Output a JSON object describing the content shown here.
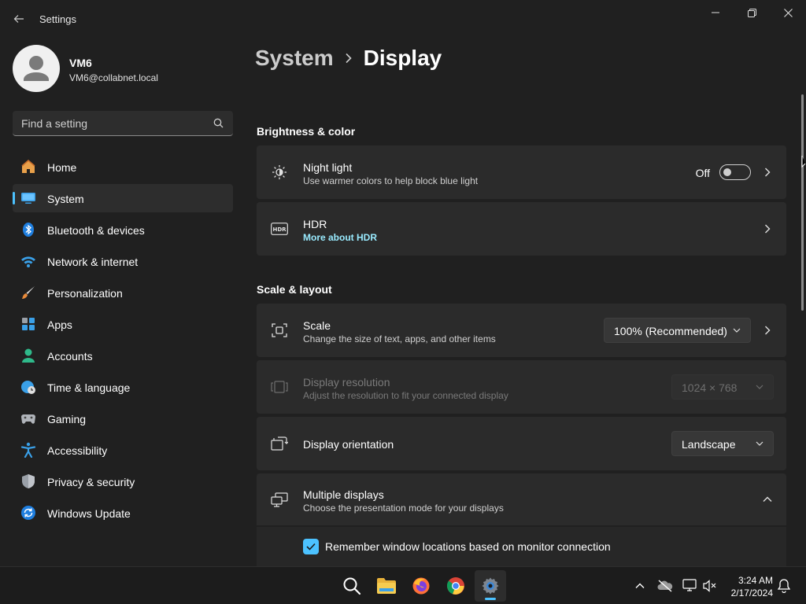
{
  "window": {
    "title": "Settings",
    "controls": [
      "minimize",
      "maximize",
      "close"
    ]
  },
  "user": {
    "name": "VM6",
    "email": "VM6@collabnet.local"
  },
  "search": {
    "placeholder": "Find a setting"
  },
  "sidebar": {
    "items": [
      {
        "label": "Home",
        "icon": "home-icon"
      },
      {
        "label": "System",
        "icon": "monitor-icon",
        "active": true
      },
      {
        "label": "Bluetooth & devices",
        "icon": "bluetooth-icon"
      },
      {
        "label": "Network & internet",
        "icon": "wifi-icon"
      },
      {
        "label": "Personalization",
        "icon": "brush-icon"
      },
      {
        "label": "Apps",
        "icon": "apps-icon"
      },
      {
        "label": "Accounts",
        "icon": "person-icon"
      },
      {
        "label": "Time & language",
        "icon": "globe-clock-icon"
      },
      {
        "label": "Gaming",
        "icon": "gamepad-icon"
      },
      {
        "label": "Accessibility",
        "icon": "accessibility-icon"
      },
      {
        "label": "Privacy & security",
        "icon": "shield-icon"
      },
      {
        "label": "Windows Update",
        "icon": "update-icon"
      }
    ]
  },
  "breadcrumb": {
    "parent": "System",
    "current": "Display"
  },
  "sections": {
    "brightness": "Brightness & color",
    "scale_layout": "Scale & layout"
  },
  "cards": {
    "night_light": {
      "title": "Night light",
      "subtitle": "Use warmer colors to help block blue light",
      "toggle_label": "Off",
      "toggle_on": false
    },
    "hdr": {
      "title": "HDR",
      "link": "More about HDR"
    },
    "scale": {
      "title": "Scale",
      "subtitle": "Change the size of text, apps, and other items",
      "value": "100% (Recommended)"
    },
    "resolution": {
      "title": "Display resolution",
      "subtitle": "Adjust the resolution to fit your connected display",
      "value": "1024 × 768",
      "disabled": true
    },
    "orientation": {
      "title": "Display orientation",
      "value": "Landscape"
    },
    "multiple_displays": {
      "title": "Multiple displays",
      "subtitle": "Choose the presentation mode for your displays",
      "expanded": true,
      "remember_label": "Remember window locations based on monitor connection",
      "remember_checked": true
    }
  },
  "taskbar": {
    "apps": [
      "search-icon",
      "file-explorer-icon",
      "firefox-icon",
      "chrome-icon",
      "settings-icon"
    ],
    "active_app": "settings-icon",
    "time": "3:24 AM",
    "date": "2/17/2024"
  },
  "colors": {
    "accent": "#4cc2ff",
    "link": "#99ebff",
    "background": "#202020",
    "card": "#2b2b2b"
  }
}
